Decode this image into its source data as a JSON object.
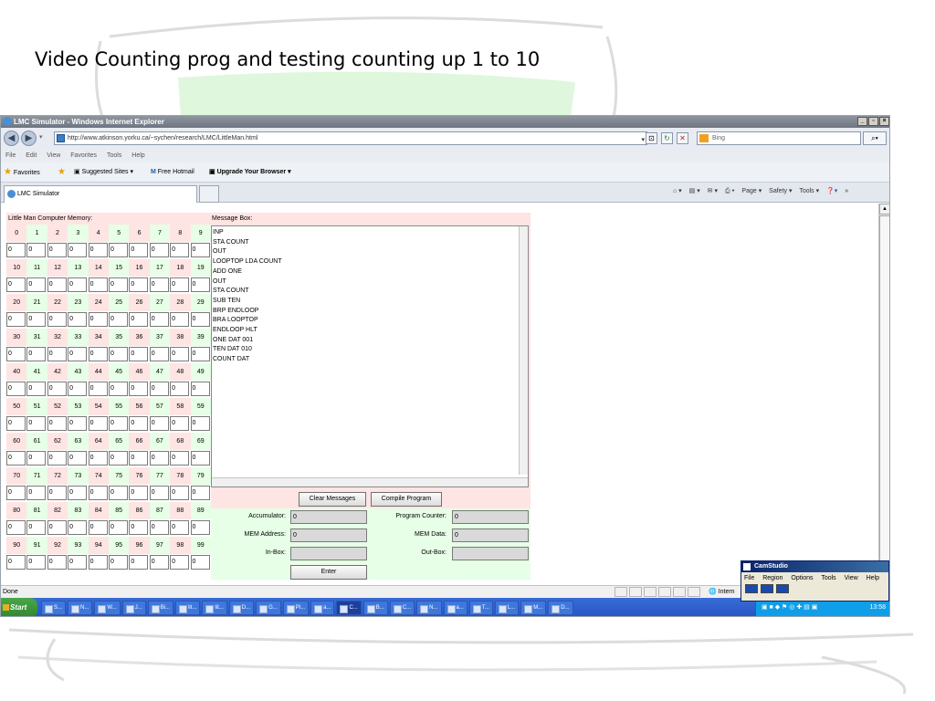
{
  "slide": {
    "title": "Video Counting prog and testing counting up 1 to 10"
  },
  "browser": {
    "window_title": "LMC Simulator - Windows Internet Explorer",
    "url": "http://www.atkinson.yorku.ca/~sychen/research/LMC/LittleMan.html",
    "search_placeholder": "Bing",
    "menu": [
      "File",
      "Edit",
      "View",
      "Favorites",
      "Tools",
      "Help"
    ],
    "favorites_label": "Favorites",
    "suggested_sites": "Suggested Sites ▾",
    "free_hotmail": "Free Hotmail",
    "upgrade": "Upgrade Your Browser ▾",
    "tab_label": "LMC Simulator",
    "command_bar": [
      "Page ▾",
      "Safety ▾",
      "Tools ▾"
    ],
    "status_text": "Done",
    "zone_text": "Intern"
  },
  "lmc": {
    "memory_title": "Little Man Computer Memory:",
    "memory_rows": [
      {
        "addresses": [
          "0",
          "1",
          "2",
          "3",
          "4",
          "5",
          "6",
          "7",
          "8",
          "9"
        ],
        "values": [
          "0",
          "0",
          "0",
          "0",
          "0",
          "0",
          "0",
          "0",
          "0",
          "0"
        ]
      },
      {
        "addresses": [
          "10",
          "11",
          "12",
          "13",
          "14",
          "15",
          "16",
          "17",
          "18",
          "19"
        ],
        "values": [
          "0",
          "0",
          "0",
          "0",
          "0",
          "0",
          "0",
          "0",
          "0",
          "0"
        ]
      },
      {
        "addresses": [
          "20",
          "21",
          "22",
          "23",
          "24",
          "25",
          "26",
          "27",
          "28",
          "29"
        ],
        "values": [
          "0",
          "0",
          "0",
          "0",
          "0",
          "0",
          "0",
          "0",
          "0",
          "0"
        ]
      },
      {
        "addresses": [
          "30",
          "31",
          "32",
          "33",
          "34",
          "35",
          "36",
          "37",
          "38",
          "39"
        ],
        "values": [
          "0",
          "0",
          "0",
          "0",
          "0",
          "0",
          "0",
          "0",
          "0",
          "0"
        ]
      },
      {
        "addresses": [
          "40",
          "41",
          "42",
          "43",
          "44",
          "45",
          "46",
          "47",
          "48",
          "49"
        ],
        "values": [
          "0",
          "0",
          "0",
          "0",
          "0",
          "0",
          "0",
          "0",
          "0",
          "0"
        ]
      },
      {
        "addresses": [
          "50",
          "51",
          "52",
          "53",
          "54",
          "55",
          "56",
          "57",
          "58",
          "59"
        ],
        "values": [
          "0",
          "0",
          "0",
          "0",
          "0",
          "0",
          "0",
          "0",
          "0",
          "0"
        ]
      },
      {
        "addresses": [
          "60",
          "61",
          "62",
          "63",
          "64",
          "65",
          "66",
          "67",
          "68",
          "69"
        ],
        "values": [
          "0",
          "0",
          "0",
          "0",
          "0",
          "0",
          "0",
          "0",
          "0",
          "0"
        ]
      },
      {
        "addresses": [
          "70",
          "71",
          "72",
          "73",
          "74",
          "75",
          "76",
          "77",
          "78",
          "79"
        ],
        "values": [
          "0",
          "0",
          "0",
          "0",
          "0",
          "0",
          "0",
          "0",
          "0",
          "0"
        ]
      },
      {
        "addresses": [
          "80",
          "81",
          "82",
          "83",
          "84",
          "85",
          "86",
          "87",
          "88",
          "89"
        ],
        "values": [
          "0",
          "0",
          "0",
          "0",
          "0",
          "0",
          "0",
          "0",
          "0",
          "0"
        ]
      },
      {
        "addresses": [
          "90",
          "91",
          "92",
          "93",
          "94",
          "95",
          "96",
          "97",
          "98",
          "99"
        ],
        "values": [
          "0",
          "0",
          "0",
          "0",
          "0",
          "0",
          "0",
          "0",
          "0",
          "0"
        ]
      }
    ],
    "message_title": "Message Box:",
    "messages": [
      "INP",
      "STA COUNT",
      "OUT",
      "LOOPTOP LDA COUNT",
      "ADD ONE",
      "OUT",
      "STA COUNT",
      "SUB TEN",
      "BRP ENDLOOP",
      "BRA LOOPTOP",
      "ENDLOOP HLT",
      "ONE DAT 001",
      "TEN DAT 010",
      "COUNT DAT"
    ],
    "clear_button": "Clear Messages",
    "compile_button": "Compile Program",
    "accumulator_label": "Accumulator:",
    "accumulator_value": "0",
    "program_counter_label": "Program Counter:",
    "program_counter_value": "0",
    "mem_address_label": "MEM Address:",
    "mem_address_value": "0",
    "mem_data_label": "MEM Data:",
    "mem_data_value": "0",
    "inbox_label": "In-Box:",
    "inbox_value": "",
    "outbox_label": "Out-Box:",
    "outbox_value": "",
    "enter_button": "Enter"
  },
  "taskbar": {
    "start_label": "Start",
    "items": [
      "S...",
      "N...",
      "W...",
      "J...",
      "Bi...",
      "lit...",
      "lit...",
      "D...",
      "G...",
      "Pl...",
      "a...",
      "C...",
      "B...",
      "C...",
      "N...",
      "a...",
      "T...",
      "L...",
      "M...",
      "D..."
    ],
    "active_item": "C...",
    "clock": "13:58"
  },
  "camstudio": {
    "title": "CamStudio",
    "menu": [
      "File",
      "Region",
      "Options",
      "Tools",
      "View",
      "Help"
    ]
  }
}
